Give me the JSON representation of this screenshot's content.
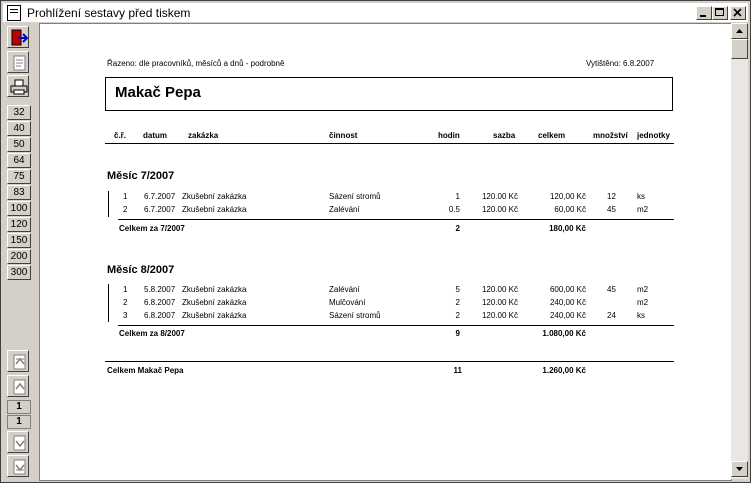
{
  "window": {
    "title": "Prohlížení sestavy před tiskem"
  },
  "toolbar": {
    "zoom_levels": [
      "32",
      "40",
      "50",
      "64",
      "75",
      "83",
      "100",
      "120",
      "150",
      "200",
      "300"
    ],
    "current_page": "1",
    "total_pages": "1"
  },
  "report": {
    "sort_note": "Řazeno: dle pracovníků, měsíců a dnů - podrobně",
    "printed": "Vytištěno: 6.8.2007",
    "employee": "Makač Pepa",
    "columns": {
      "no": "č.ř.",
      "date": "datum",
      "order": "zakázka",
      "activity": "činnost",
      "hours": "hodin",
      "rate": "sazba",
      "total": "celkem",
      "qty": "množství",
      "unit": "jednotky"
    },
    "months": [
      {
        "title": "Měsíc 7/2007",
        "rows": [
          {
            "no": "1",
            "date": "6.7.2007",
            "order": "Zkušební zakázka",
            "activity": "Sázení stromů",
            "hours": "1",
            "rate": "120.00 Kč",
            "total": "120,00 Kč",
            "qty": "12",
            "unit": "ks"
          },
          {
            "no": "2",
            "date": "6.7.2007",
            "order": "Zkušební zakázka",
            "activity": "Zalévání",
            "hours": "0.5",
            "rate": "120.00 Kč",
            "total": "60,00 Kč",
            "qty": "45",
            "unit": "m2"
          }
        ],
        "subtotal_label": "Celkem za 7/2007",
        "subtotal_hours": "2",
        "subtotal_total": "180,00 Kč"
      },
      {
        "title": "Měsíc 8/2007",
        "rows": [
          {
            "no": "1",
            "date": "5.8.2007",
            "order": "Zkušební zakázka",
            "activity": "Zalévání",
            "hours": "5",
            "rate": "120.00 Kč",
            "total": "600,00 Kč",
            "qty": "45",
            "unit": "m2"
          },
          {
            "no": "2",
            "date": "6.8.2007",
            "order": "Zkušební zakázka",
            "activity": "Mulčování",
            "hours": "2",
            "rate": "120.00 Kč",
            "total": "240,00 Kč",
            "qty": "",
            "unit": "m2"
          },
          {
            "no": "3",
            "date": "6.8.2007",
            "order": "Zkušební zakázka",
            "activity": "Sázení stromů",
            "hours": "2",
            "rate": "120.00 Kč",
            "total": "240,00 Kč",
            "qty": "24",
            "unit": "ks"
          }
        ],
        "subtotal_label": "Celkem za 8/2007",
        "subtotal_hours": "9",
        "subtotal_total": "1.080,00 Kč"
      }
    ],
    "grand_total_label": "Celkem Makač Pepa",
    "grand_total_hours": "11",
    "grand_total_total": "1.260,00 Kč"
  }
}
